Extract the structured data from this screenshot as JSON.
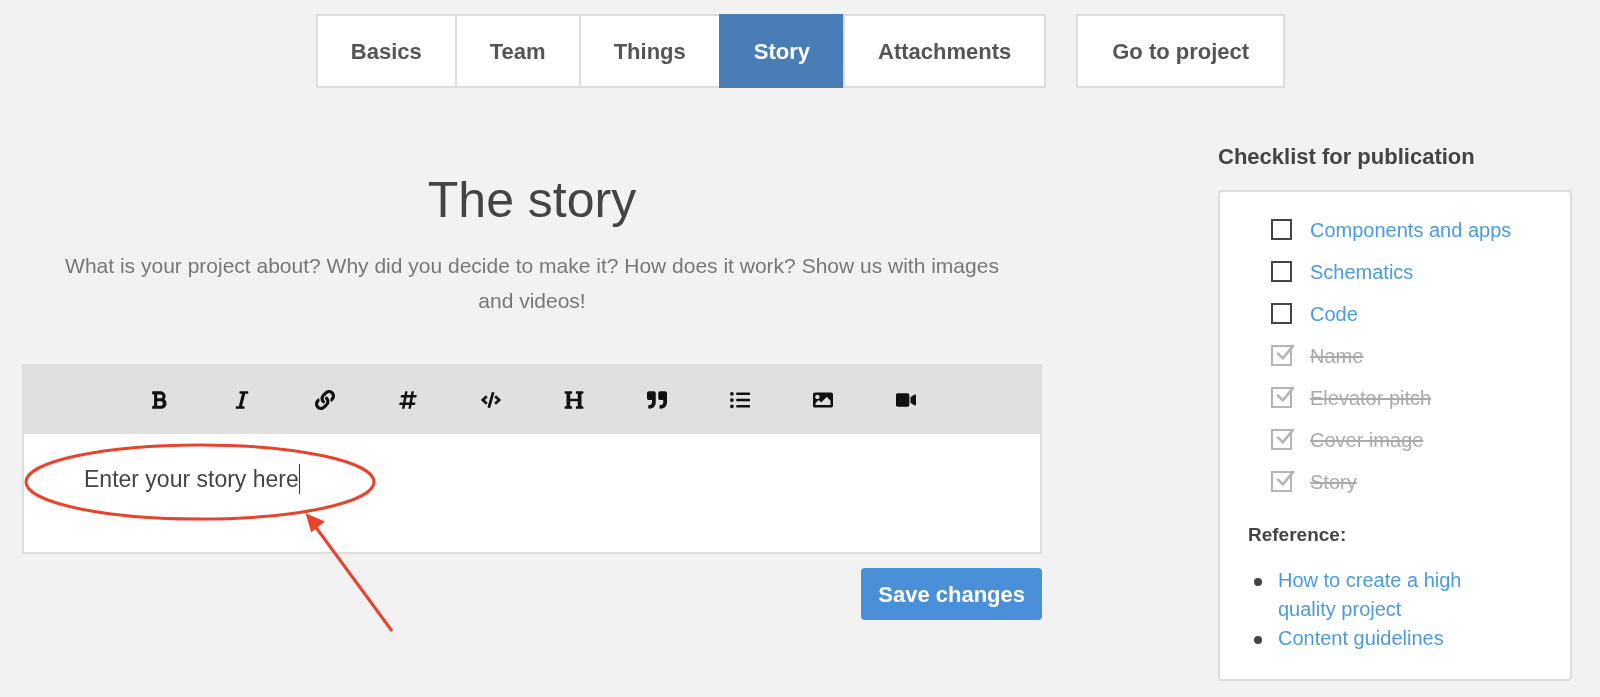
{
  "tabs": [
    {
      "label": "Basics",
      "selected": false
    },
    {
      "label": "Team",
      "selected": false
    },
    {
      "label": "Things",
      "selected": false
    },
    {
      "label": "Story",
      "selected": true
    },
    {
      "label": "Attachments",
      "selected": false
    }
  ],
  "go_to_project": "Go to project",
  "heading": "The story",
  "subtitle": "What is your project about? Why did you decide to make it? How does it work? Show us with images and videos!",
  "editor": {
    "toolbar": [
      {
        "kind": "bold"
      },
      {
        "kind": "italic"
      },
      {
        "kind": "link"
      },
      {
        "kind": "hashtag"
      },
      {
        "kind": "code"
      },
      {
        "kind": "heading"
      },
      {
        "kind": "quote"
      },
      {
        "kind": "list"
      },
      {
        "kind": "image"
      },
      {
        "kind": "video"
      }
    ],
    "value": "Enter your story here"
  },
  "save_button": "Save changes",
  "checklist": {
    "title": "Checklist for publication",
    "items": [
      {
        "label": "Components and apps",
        "checked": false
      },
      {
        "label": "Schematics",
        "checked": false
      },
      {
        "label": "Code",
        "checked": false
      },
      {
        "label": "Name",
        "checked": true
      },
      {
        "label": "Elevator pitch",
        "checked": true
      },
      {
        "label": "Cover image",
        "checked": true
      },
      {
        "label": "Story",
        "checked": true
      }
    ],
    "reference_title": "Reference:",
    "references": [
      "How to create a high quality project",
      "Content guidelines"
    ]
  }
}
